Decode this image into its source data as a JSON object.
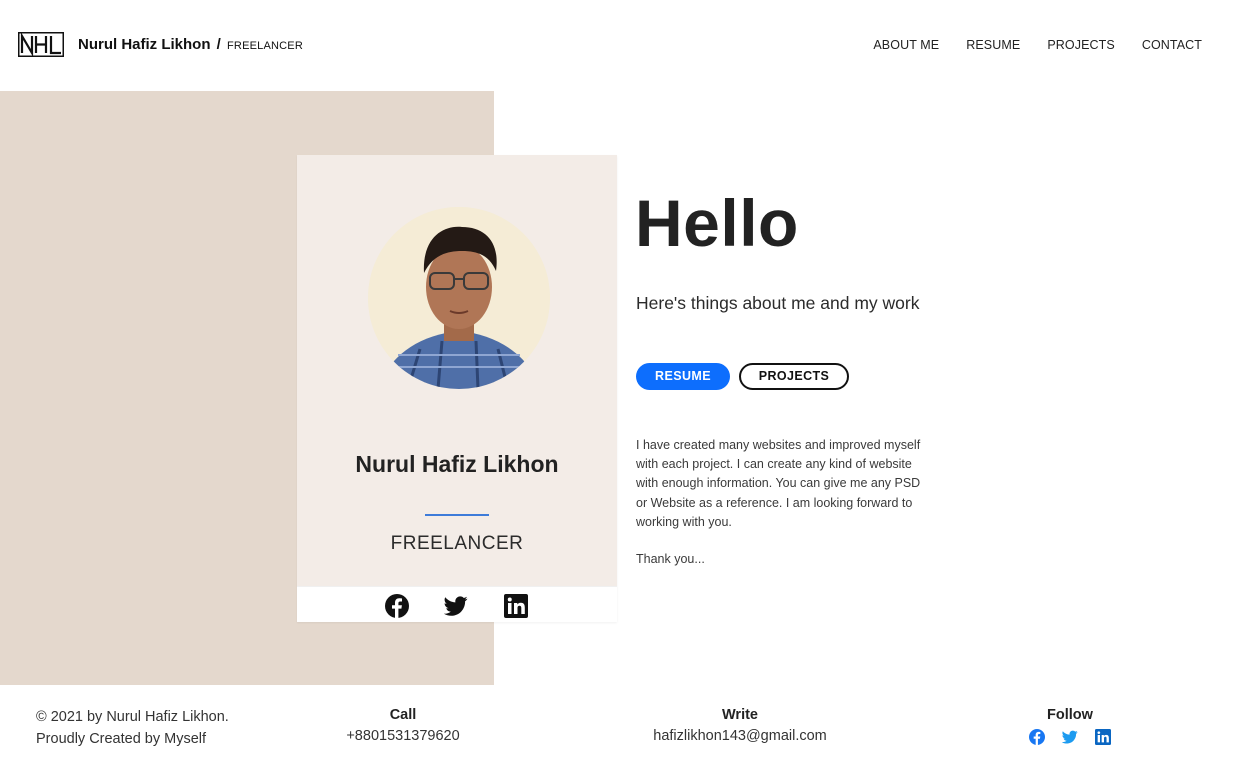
{
  "header": {
    "logo_text": "NHL",
    "brand_name": "Nurul Hafiz Likhon",
    "brand_separator": "/",
    "brand_role": "FREELANCER",
    "nav": [
      "ABOUT ME",
      "RESUME",
      "PROJECTS",
      "CONTACT"
    ]
  },
  "card": {
    "name": "Nurul Hafiz Likhon",
    "role": "FREELANCER",
    "social_icons": [
      "facebook-icon",
      "twitter-icon",
      "linkedin-icon"
    ]
  },
  "main": {
    "heading": "Hello",
    "tagline": "Here's things about me and my work",
    "buttons": {
      "resume": "RESUME",
      "projects": "PROJECTS"
    },
    "about": "I have created many websites and improved myself with each project. I can create any kind of website with enough information. You can give me any PSD or Website as a reference. I am looking forward to working with you.",
    "thanks": "Thank you..."
  },
  "footer": {
    "copyright_line1": "© 2021 by Nurul Hafiz Likhon.",
    "copyright_line2": "Proudly Created by Myself",
    "call_heading": "Call",
    "call_value": "+8801531379620",
    "write_heading": "Write",
    "write_value": "hafizlikhon143@gmail.com",
    "follow_heading": "Follow",
    "follow_icons": [
      "facebook-icon",
      "twitter-icon",
      "linkedin-icon"
    ]
  },
  "colors": {
    "accent": "#0d6efd",
    "panel_beige": "#e4d8cd",
    "card_bg": "#f3ece7",
    "name_rule": "#3d7bd9"
  }
}
